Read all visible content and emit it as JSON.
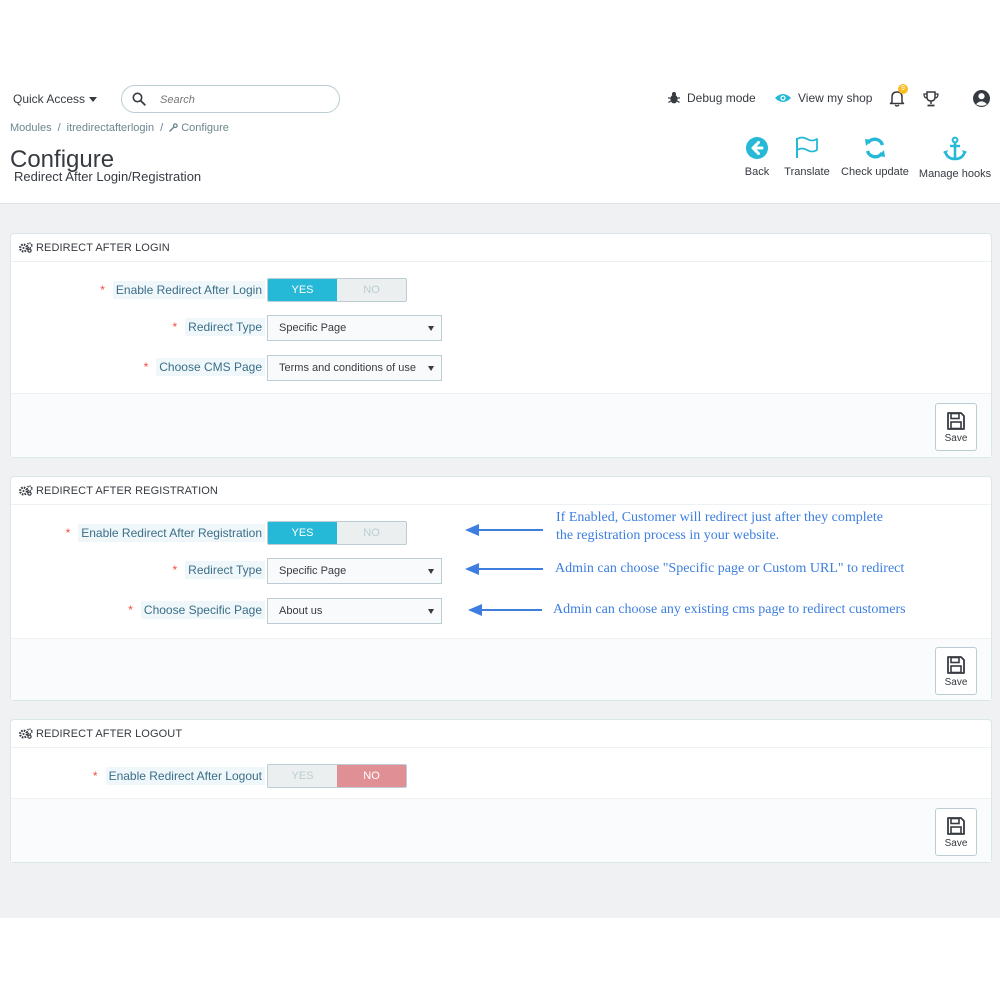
{
  "header": {
    "quick_access": "Quick Access",
    "search_placeholder": "Search",
    "debug_mode": "Debug mode",
    "view_shop": "View my shop",
    "notification_count": "9"
  },
  "breadcrumb": [
    "Modules",
    "itredirectafterlogin",
    "Configure"
  ],
  "page": {
    "title": "Configure",
    "subtitle": "Redirect After Login/Registration"
  },
  "toolbar": {
    "back": "Back",
    "translate": "Translate",
    "check_update": "Check update",
    "manage_hooks": "Manage hooks"
  },
  "colors": {
    "accent": "#25b9d7",
    "no_active": "#e08f95",
    "required": "#f54c3e",
    "annotation": "#3d7ee0"
  },
  "panels": {
    "login": {
      "heading": "REDIRECT AFTER LOGIN",
      "enable_label": "Enable Redirect After Login",
      "enable_value": "YES",
      "redirect_type_label": "Redirect Type",
      "redirect_type_value": "Specific Page",
      "cms_label": "Choose CMS Page",
      "cms_value": "Terms and conditions of use",
      "save": "Save"
    },
    "registration": {
      "heading": "REDIRECT AFTER REGISTRATION",
      "enable_label": "Enable Redirect After Registration",
      "enable_value": "YES",
      "redirect_type_label": "Redirect Type",
      "redirect_type_value": "Specific Page",
      "page_label": "Choose Specific Page",
      "page_value": "About us",
      "save": "Save"
    },
    "logout": {
      "heading": "REDIRECT AFTER LOGOUT",
      "enable_label": "Enable Redirect After Logout",
      "enable_value": "NO",
      "save": "Save"
    }
  },
  "switch_labels": {
    "yes": "YES",
    "no": "NO"
  },
  "annotations": {
    "enable_line1": "If Enabled, Customer will redirect just after they complete",
    "enable_line2": "the registration process in your website.",
    "type": "Admin can choose \"Specific page or Custom URL\" to redirect",
    "page": "Admin can choose any existing cms page to redirect customers"
  }
}
